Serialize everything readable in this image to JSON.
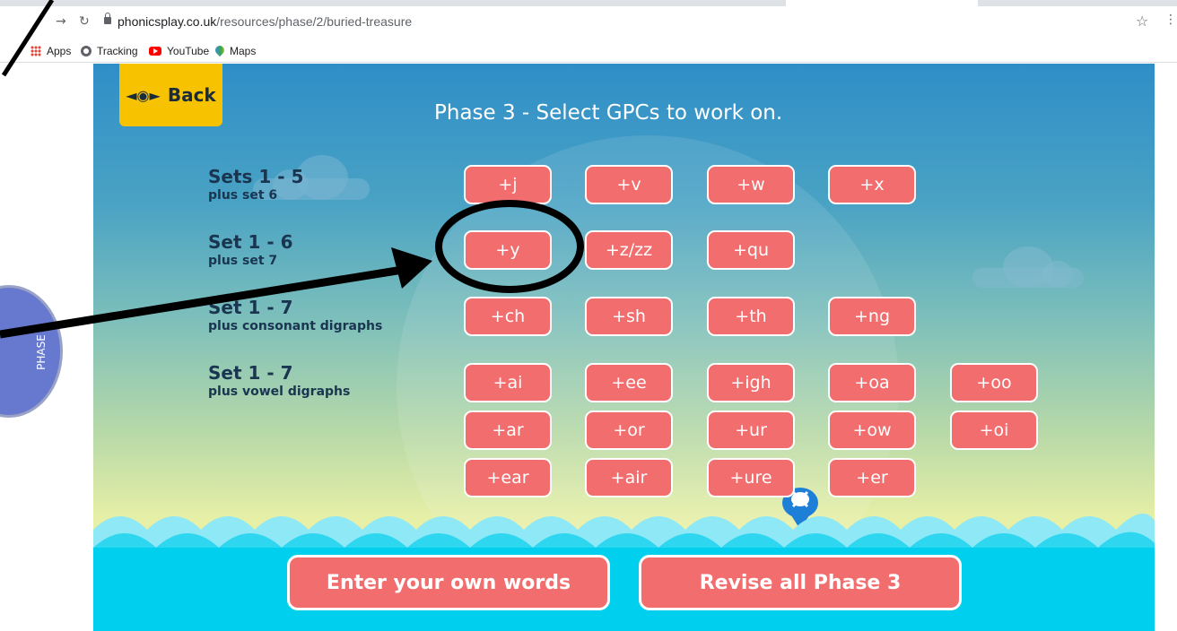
{
  "browser": {
    "url_domain": "phonicsplay.co.uk",
    "url_path": "/resources/phase/2/buried-treasure",
    "bookmarks": [
      {
        "label": "Apps",
        "icon": "apps-grid-icon"
      },
      {
        "label": "Tracking",
        "icon": "globe-icon"
      },
      {
        "label": "YouTube",
        "icon": "youtube-icon"
      },
      {
        "label": "Maps",
        "icon": "maps-pin-icon"
      }
    ]
  },
  "game": {
    "back_label": "Back",
    "title": "Phase 3 - Select GPCs to work on.",
    "side_tab_label": "PHASE",
    "groups": [
      {
        "title": "Sets 1 - 5",
        "subtitle": "plus set 6",
        "buttons": [
          "+j",
          "+v",
          "+w",
          "+x"
        ]
      },
      {
        "title": "Set 1 - 6",
        "subtitle": "plus set 7",
        "buttons": [
          "+y",
          "+z/zz",
          "+qu"
        ]
      },
      {
        "title": "Set 1 - 7",
        "subtitle": "plus consonant digraphs",
        "buttons": [
          "+ch",
          "+sh",
          "+th",
          "+ng"
        ]
      },
      {
        "title": "Set 1 - 7",
        "subtitle": "plus vowel digraphs",
        "buttons": [
          "+ai",
          "+ee",
          "+igh",
          "+oa",
          "+oo",
          "+ar",
          "+or",
          "+ur",
          "+ow",
          "+oi",
          "+ear",
          "+air",
          "+ure",
          "+er"
        ]
      }
    ],
    "bottom_buttons": {
      "own_words": "Enter your own words",
      "revise_all": "Revise all Phase 3"
    }
  },
  "colors": {
    "gpc_button": "#f26d6d",
    "back_button": "#f7c300",
    "sea": "#00cfee",
    "annotation": "#000000"
  }
}
